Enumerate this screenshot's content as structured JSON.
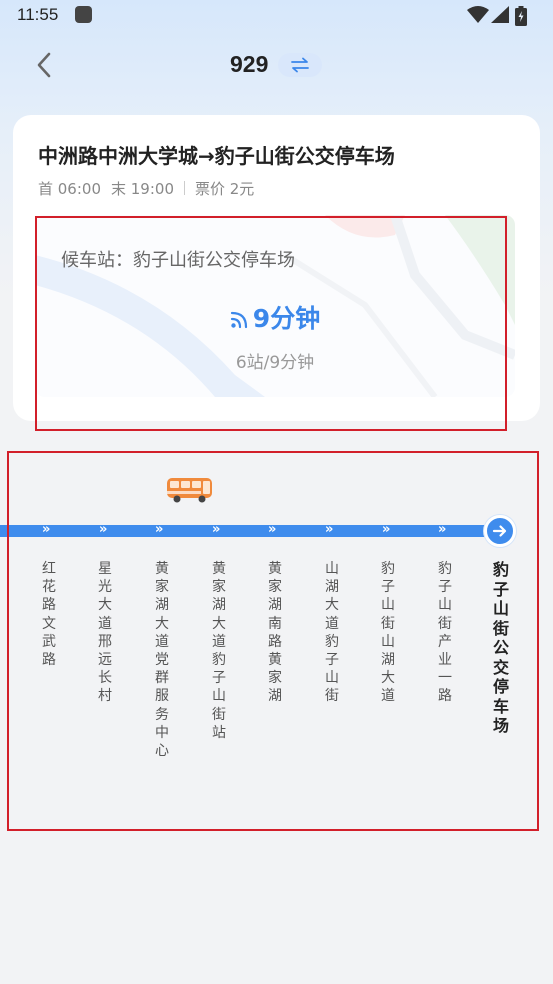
{
  "status_bar": {
    "time": "11:55"
  },
  "nav": {
    "route_number": "929"
  },
  "card": {
    "title": "中洲路中洲大学城→豹子山街公交停车场",
    "first_bus": "首 06:00",
    "last_bus": "末 19:00",
    "fare": "票价 2元",
    "wait_station": "候车站：豹子山街公交停车场",
    "eta": "9分钟",
    "eta_detail": "6站/9分钟"
  },
  "colors": {
    "accent": "#3f8ced",
    "highlight": "#d21f2a",
    "eta_text": "#3b87ea"
  },
  "icons": [
    "signal-bars-icon",
    "wifi-icon",
    "battery-icon",
    "back-chevron-icon",
    "swap-icon",
    "realtime-signal-icon",
    "bus-icon",
    "arrow-right-icon"
  ],
  "stops": [
    {
      "name": "红花路文武路"
    },
    {
      "name": "星光大道邢远长村"
    },
    {
      "name": "黄家湖大道党群服务中心"
    },
    {
      "name": "黄家湖大道豹子山街站"
    },
    {
      "name": "黄家湖南路黄家湖"
    },
    {
      "name": "山湖大道豹子山街"
    },
    {
      "name": "豹子山街山湖大道"
    },
    {
      "name": "豹子山街产业一路"
    },
    {
      "name": "豹子山街公交停车场",
      "current": true
    }
  ]
}
